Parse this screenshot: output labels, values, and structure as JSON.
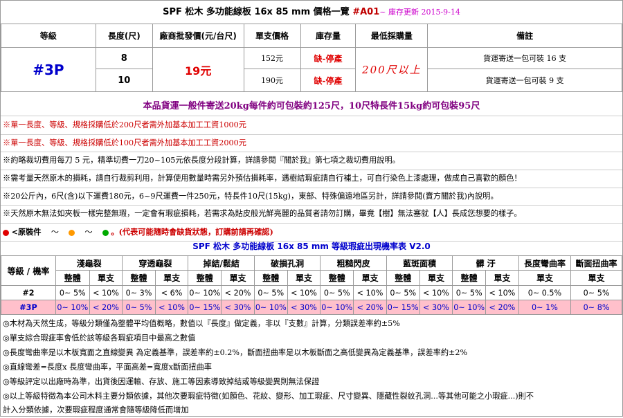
{
  "header": {
    "title_main": "SPF 松木 多功能線板 16x 85 mm 價格一覽 ",
    "title_code": "#A01",
    "title_update": "~ 庫存更新 2015-9-14"
  },
  "price_table": {
    "headers": [
      "等級",
      "長度(尺)",
      "廠商批發價(元/台尺)",
      "單支價格",
      "庫存量",
      "最低採購量",
      "備註"
    ],
    "grade": "#3P",
    "wholesale_price": "19",
    "wholesale_unit": "元",
    "min_purchase": "200尺以上",
    "rows": [
      {
        "length": "8",
        "unit_price": "152元",
        "stock": "缺-停產",
        "note": "貨運寄送一包可裝 16 支"
      },
      {
        "length": "10",
        "unit_price": "190元",
        "stock": "缺-停產",
        "note": "貨運寄送一包可裝 9 支"
      }
    ]
  },
  "shipping_notice": "本品貨運一般件寄送20kg每件約可包裝約125尺，10尺特長件15kg約可包裝95尺",
  "notes": [
    "※單一長度、等級、規格採購低於200尺者需外加基本加工工資1000元",
    "※單一長度、等級、規格採購低於100尺者需外加基本加工工資2000元",
    "※約略裁切費用每刀 5 元，精準切費一刀20~105元依長度分段計算，詳請參閱『關於我』第七項之裁切費用說明。",
    "※需考量天然原木的損耗，請自行裁剪利用，計算使用數量時需另外預估損耗率，遇樹結瑕疵請自行補土，可自行染色上漆處理，做成自己喜歡的顏色！",
    "※20公斤內，6尺(含)以下運費180元，6~9尺運費一件250元，特長件10尺(15kg)，東部、特殊偏遠地區另計，詳請參閱(賣方關於我)內說明。",
    "※天然原木無法如夾板一樣完整無瑕，一定會有瑕疵損耗，若需求為貼皮般光鮮亮麗的品質者請勿訂購，畢竟【樹】無法塞就【人】長成您想要的樣子。"
  ],
  "legend": {
    "label": "<原裝件",
    "tilde": "～",
    "notice": "。(代表可能隨時會缺貨狀態，訂購前請再確認)",
    "colors": [
      "#e00000",
      "#ff9900",
      "#00aa00"
    ],
    "icon_names": [
      "red-dot-icon",
      "orange-dot-icon",
      "green-dot-icon"
    ]
  },
  "defect_title": "SPF 松木 多功能線板 16x 85 mm 等級瑕疵出現機率表 V2.0",
  "defect_table": {
    "corner": "等級 / 機率",
    "groups": [
      {
        "name": "淺龜裂",
        "subs": [
          "整體",
          "單支"
        ]
      },
      {
        "name": "穿透龜裂",
        "subs": [
          "整體",
          "單支"
        ]
      },
      {
        "name": "掉結/鬆結",
        "subs": [
          "整體",
          "單支"
        ]
      },
      {
        "name": "破損孔洞",
        "subs": [
          "整體",
          "單支"
        ]
      },
      {
        "name": "粗糙閃皮",
        "subs": [
          "整體",
          "單支"
        ]
      },
      {
        "name": "藍斑面積",
        "subs": [
          "整體",
          "單支"
        ]
      },
      {
        "name": "髒 汙",
        "subs": [
          "整體",
          "單支"
        ]
      },
      {
        "name": "長度彎曲率",
        "subs": [
          "單支"
        ]
      },
      {
        "name": "斷面扭曲率",
        "subs": [
          "單支"
        ]
      }
    ],
    "rows": [
      {
        "grade": "#2",
        "values": [
          "0~ 5%",
          "< 10%",
          "0~ 3%",
          "< 6%",
          "0~ 10%",
          "< 20%",
          "0~ 5%",
          "< 10%",
          "0~ 5%",
          "< 10%",
          "0~ 5%",
          "< 10%",
          "0~ 5%",
          "< 10%",
          "0~ 0.5%",
          "0~ 5%"
        ]
      },
      {
        "grade": "#3P",
        "values": [
          "0~ 10%",
          "< 20%",
          "0~ 5%",
          "< 10%",
          "0~ 15%",
          "< 30%",
          "0~ 10%",
          "< 30%",
          "0~ 10%",
          "< 20%",
          "0~ 15%",
          "< 30%",
          "0~ 10%",
          "< 20%",
          "0~ 1%",
          "0~ 8%"
        ]
      }
    ]
  },
  "footnotes": [
    "◎木材為天然生成，等級分類僅為整體平均值概略，數值以『長度』做定義，非以『支數』計算，分類誤差率約±5%",
    "◎單支綜合瑕疵率會低於該等級各瑕疵項目中最高之數值",
    "◎長度彎曲率是以木板寬面之直線變異 為定義基準，誤差率約±0.2%，斷面扭曲率是以木板斷面之高低變異為定義基準，誤差率約±2%",
    "◎直線彎差=長度x 長度彎曲率，平面高差=寬度x斷面扭曲率",
    "◎等級評定以出廠時為準，出貨後因運輸、存放、施工等因素導致掉結或等級變異則無法保證",
    "◎以上等級特徵為本公司木料主要分類依據，其他次要瑕疵特徵(如顏色、花紋、變形、加工瑕疵、尺寸變異、隱藏性裂紋孔洞...等其他可能之小瑕疵...)則不",
    "計入分類依據，次要瑕疵程度通常會隨等級降低而增加"
  ]
}
